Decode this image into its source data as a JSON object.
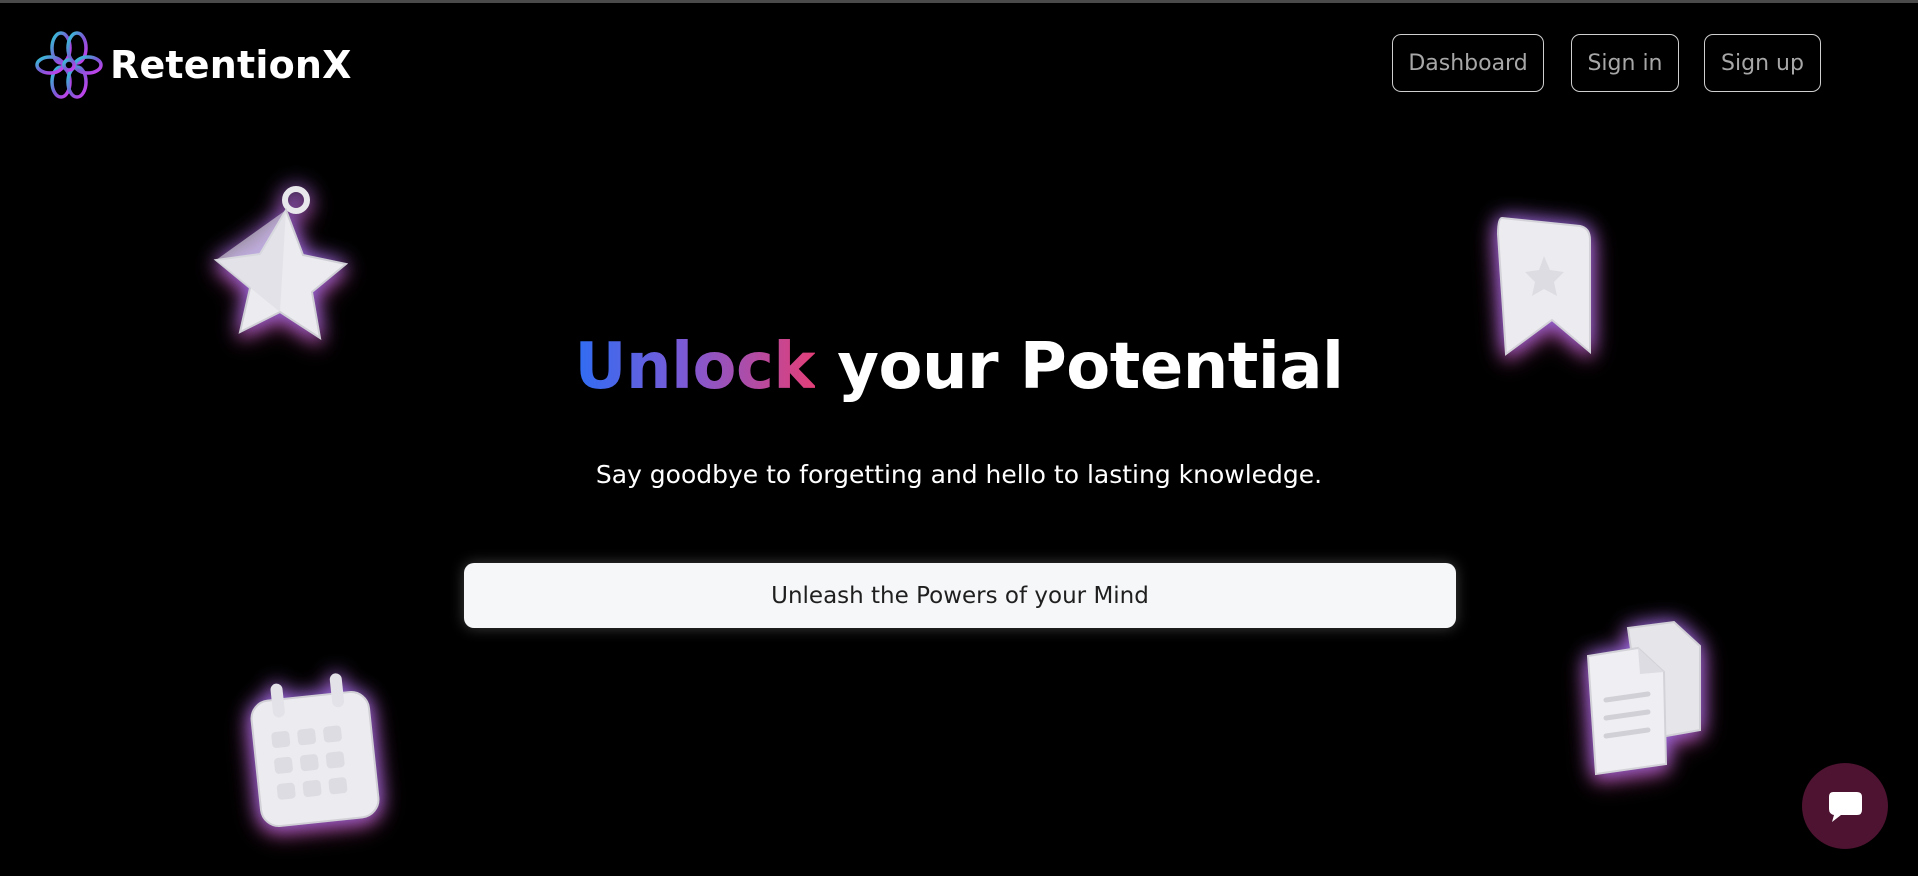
{
  "brand": {
    "name": "RetentionX"
  },
  "nav": {
    "dashboard_label": "Dashboard",
    "signin_label": "Sign in",
    "signup_label": "Sign up"
  },
  "hero": {
    "title_highlight": "Unlock",
    "title_rest": " your Potential",
    "subtitle": "Say goodbye to forgetting and hello to lasting knowledge.",
    "cta_label": "Unleash the Powers of your Mind"
  },
  "decorations": [
    "star-icon",
    "bookmark-icon",
    "calendar-icon",
    "documents-icon"
  ],
  "chat": {
    "icon": "chat-icon"
  },
  "colors": {
    "background": "#000000",
    "gradient_start": "#2f6df3",
    "gradient_mid": "#7b5ad6",
    "gradient_end": "#e23f78",
    "chat_button": "#4d1330",
    "cta_background": "#f6f7f9"
  }
}
